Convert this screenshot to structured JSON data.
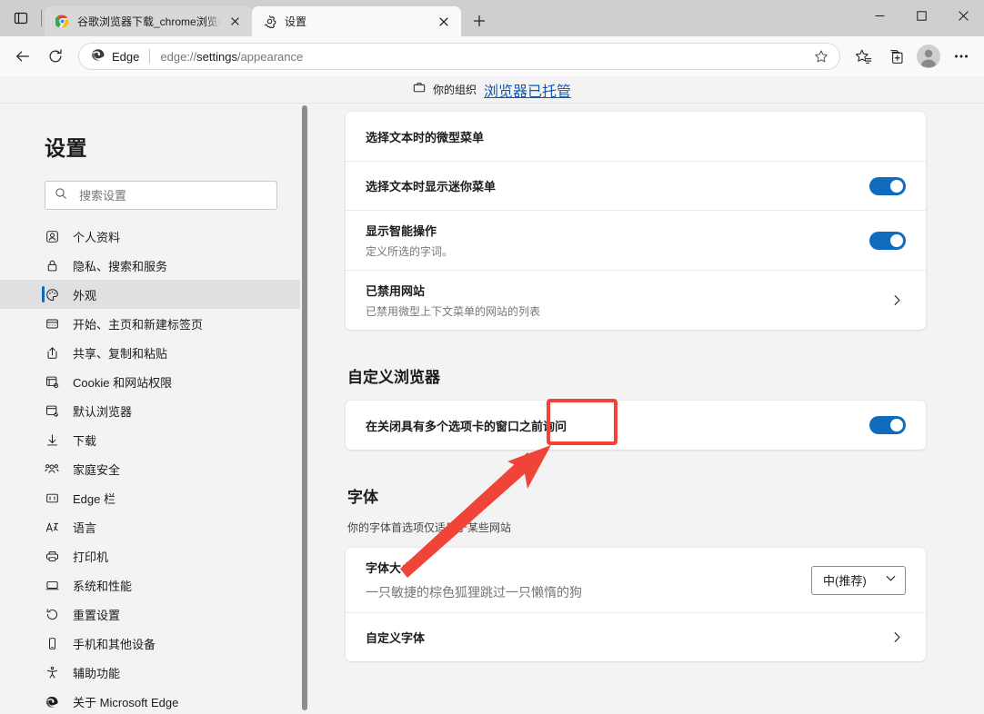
{
  "window": {
    "minimize_label": "最小化",
    "maximize_label": "最大化",
    "close_label": "关闭",
    "tab_search_label": "选项卡操作菜单"
  },
  "tabs": [
    {
      "title": "谷歌浏览器下载_chrome浏览器官",
      "favicon": "chrome-icon",
      "active": false,
      "close_label": "×"
    },
    {
      "title": "设置",
      "favicon": "gear-icon",
      "active": true,
      "close_label": "×"
    }
  ],
  "new_tab_label": "+",
  "toolbar": {
    "back_label": "←",
    "refresh_label": "⟳",
    "brand_label": "Edge",
    "url_prefix": "edge://",
    "url_bold": "settings",
    "url_suffix": "/appearance",
    "url_full": "edge://settings/appearance",
    "favorite_label": "添加到收藏夹",
    "favorites_label": "收藏夹",
    "collections_label": "集锦",
    "profile_label": "个人资料",
    "more_label": "设置及其他"
  },
  "managed_banner": {
    "icon": "briefcase-icon",
    "text": "你的组织",
    "link": "浏览器已托管"
  },
  "sidebar": {
    "title": "设置",
    "search": {
      "placeholder": "搜索设置",
      "value": ""
    },
    "items": [
      {
        "label": "个人资料",
        "icon": "profile-icon",
        "selected": false
      },
      {
        "label": "隐私、搜索和服务",
        "icon": "lock-icon",
        "selected": false
      },
      {
        "label": "外观",
        "icon": "palette-icon",
        "selected": true
      },
      {
        "label": "开始、主页和新建标签页",
        "icon": "newtab-icon",
        "selected": false
      },
      {
        "label": "共享、复制和粘贴",
        "icon": "share-icon",
        "selected": false
      },
      {
        "label": "Cookie 和网站权限",
        "icon": "cookie-icon",
        "selected": false
      },
      {
        "label": "默认浏览器",
        "icon": "default-browser-icon",
        "selected": false
      },
      {
        "label": "下载",
        "icon": "download-icon",
        "selected": false
      },
      {
        "label": "家庭安全",
        "icon": "family-icon",
        "selected": false
      },
      {
        "label": "Edge 栏",
        "icon": "edgebar-icon",
        "selected": false
      },
      {
        "label": "语言",
        "icon": "language-icon",
        "selected": false
      },
      {
        "label": "打印机",
        "icon": "printer-icon",
        "selected": false
      },
      {
        "label": "系统和性能",
        "icon": "system-icon",
        "selected": false
      },
      {
        "label": "重置设置",
        "icon": "reset-icon",
        "selected": false
      },
      {
        "label": "手机和其他设备",
        "icon": "phone-icon",
        "selected": false
      },
      {
        "label": "辅助功能",
        "icon": "accessibility-icon",
        "selected": false
      },
      {
        "label": "关于 Microsoft Edge",
        "icon": "edge-icon",
        "selected": false
      }
    ]
  },
  "main": {
    "mini_menu_card": {
      "header": "选择文本时的微型菜单",
      "rows": [
        {
          "title": "选择文本时显示迷你菜单",
          "sub": "",
          "control": "toggle",
          "toggle_on": true
        },
        {
          "title": "显示智能操作",
          "sub": "定义所选的字词。",
          "control": "toggle",
          "toggle_on": true
        },
        {
          "title": "已禁用网站",
          "sub": "已禁用微型上下文菜单的网站的列表",
          "control": "chevron"
        }
      ]
    },
    "customize_section": {
      "heading": "自定义浏览器",
      "rows": [
        {
          "title": "在关闭具有多个选项卡的窗口之前询问",
          "sub": "",
          "control": "toggle",
          "toggle_on": true,
          "highlighted": true
        }
      ]
    },
    "fonts_section": {
      "heading": "字体",
      "description": "你的字体首选项仅适用于某些网站",
      "rows": [
        {
          "title": "字体大小",
          "sub": "一只敏捷的棕色狐狸跳过一只懒惰的狗",
          "control": "dropdown",
          "dropdown_value": "中(推荐)"
        },
        {
          "title": "自定义字体",
          "sub": "",
          "control": "chevron"
        }
      ]
    }
  },
  "annotations": {
    "highlight_color": "#f04438",
    "arrow_color": "#f04438"
  }
}
